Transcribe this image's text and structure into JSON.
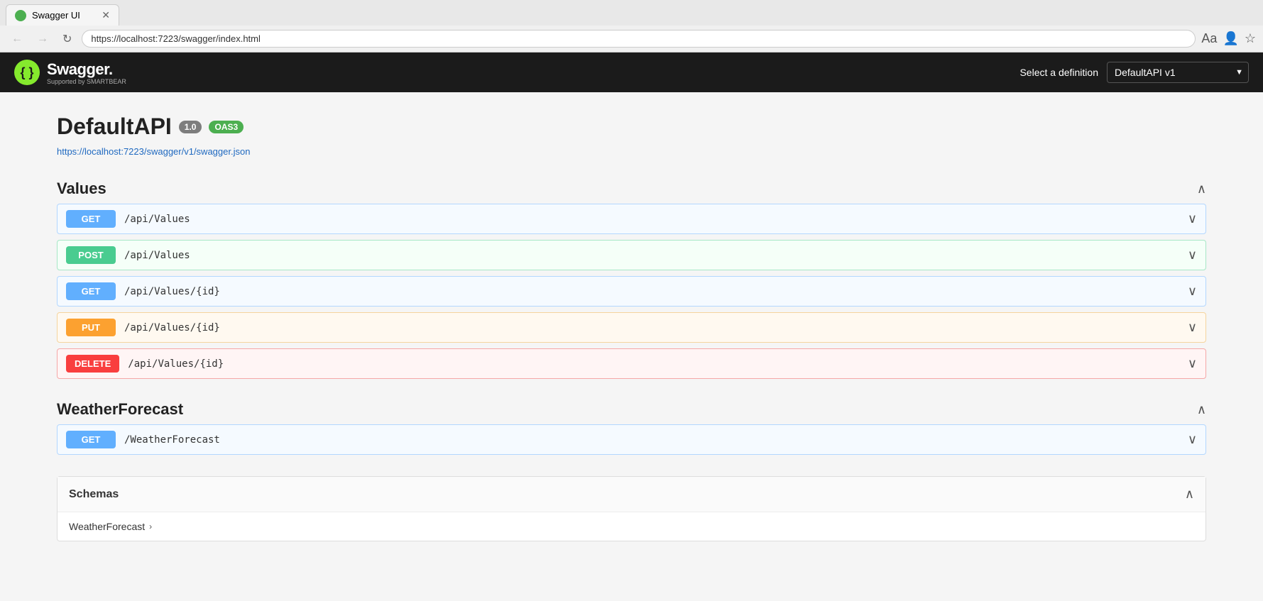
{
  "browser": {
    "tab_label": "Swagger UI",
    "url": "https://localhost:7223/swagger/index.html",
    "nav": {
      "back": "←",
      "forward": "→",
      "refresh": "↻"
    },
    "icons": {
      "read_mode": "Aa",
      "favorites": "☆",
      "account": "👤"
    }
  },
  "swagger": {
    "logo_icon": "{ }",
    "logo_text": "Swagger.",
    "logo_sub": "Supported by SMARTBEAR",
    "definition_label": "Select a definition",
    "definition_select": "DefaultAPI v1",
    "definition_options": [
      "DefaultAPI v1"
    ]
  },
  "api": {
    "title": "DefaultAPI",
    "version_badge": "1.0",
    "oas_badge": "OAS3",
    "spec_url": "https://localhost:7223/swagger/v1/swagger.json"
  },
  "sections": [
    {
      "id": "values",
      "title": "Values",
      "expanded": true,
      "endpoints": [
        {
          "method": "GET",
          "path": "/api/Values",
          "id": "get-values"
        },
        {
          "method": "POST",
          "path": "/api/Values",
          "id": "post-values"
        },
        {
          "method": "GET",
          "path": "/api/Values/{id}",
          "id": "get-values-id"
        },
        {
          "method": "PUT",
          "path": "/api/Values/{id}",
          "id": "put-values-id"
        },
        {
          "method": "DELETE",
          "path": "/api/Values/{id}",
          "id": "delete-values-id"
        }
      ]
    },
    {
      "id": "weather-forecast",
      "title": "WeatherForecast",
      "expanded": true,
      "endpoints": [
        {
          "method": "GET",
          "path": "/WeatherForecast",
          "id": "get-weather-forecast"
        }
      ]
    }
  ],
  "schemas": {
    "title": "Schemas",
    "items": [
      {
        "name": "WeatherForecast",
        "id": "schema-weather-forecast"
      }
    ]
  },
  "colors": {
    "get": "#61affe",
    "post": "#49cc90",
    "put": "#fca130",
    "delete": "#f93e3e"
  }
}
